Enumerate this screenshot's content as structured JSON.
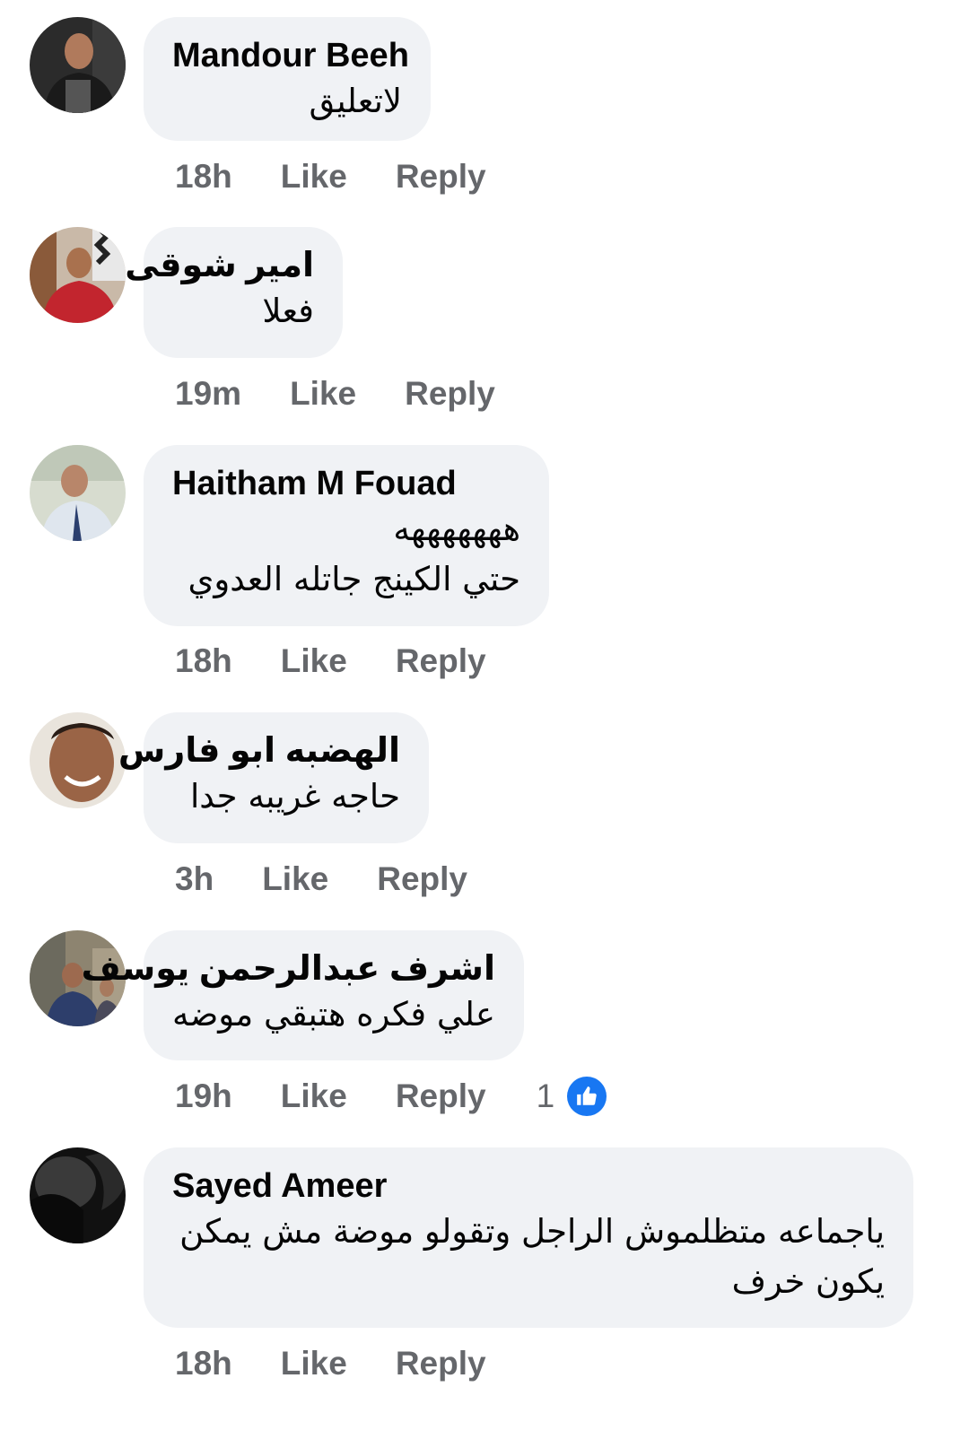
{
  "comments": [
    {
      "author": "Mandour Beeh",
      "lines": [
        "لاتعليق"
      ],
      "time": "18h",
      "like": "Like",
      "reply": "Reply"
    },
    {
      "author": "امير شوقى",
      "lines": [
        "فعلا"
      ],
      "time": "19m",
      "like": "Like",
      "reply": "Reply"
    },
    {
      "author": "Haitham M Fouad",
      "lines": [
        "هههههههه",
        "حتي الكينج جاتله العدوي"
      ],
      "time": "18h",
      "like": "Like",
      "reply": "Reply"
    },
    {
      "author": "الهضبه ابو فارس",
      "lines": [
        "حاجه غريبه جدا"
      ],
      "time": "3h",
      "like": "Like",
      "reply": "Reply"
    },
    {
      "author": "اشرف عبدالرحمن يوسف",
      "lines": [
        "علي فكره هتبقي موضه"
      ],
      "time": "19h",
      "like": "Like",
      "reply": "Reply",
      "reaction_count": "1"
    },
    {
      "author": "Sayed Ameer",
      "lines": [
        "ياجماعه متظلموش الراجل وتقولو موضة مش يمكن",
        "يكون خرف"
      ],
      "time": "18h",
      "like": "Like",
      "reply": "Reply"
    }
  ],
  "colors": {
    "bubble": "#f0f2f5",
    "meta": "#65676b",
    "like_badge": "#1877f2"
  },
  "icons": {
    "reaction": "thumbs-up-icon"
  }
}
